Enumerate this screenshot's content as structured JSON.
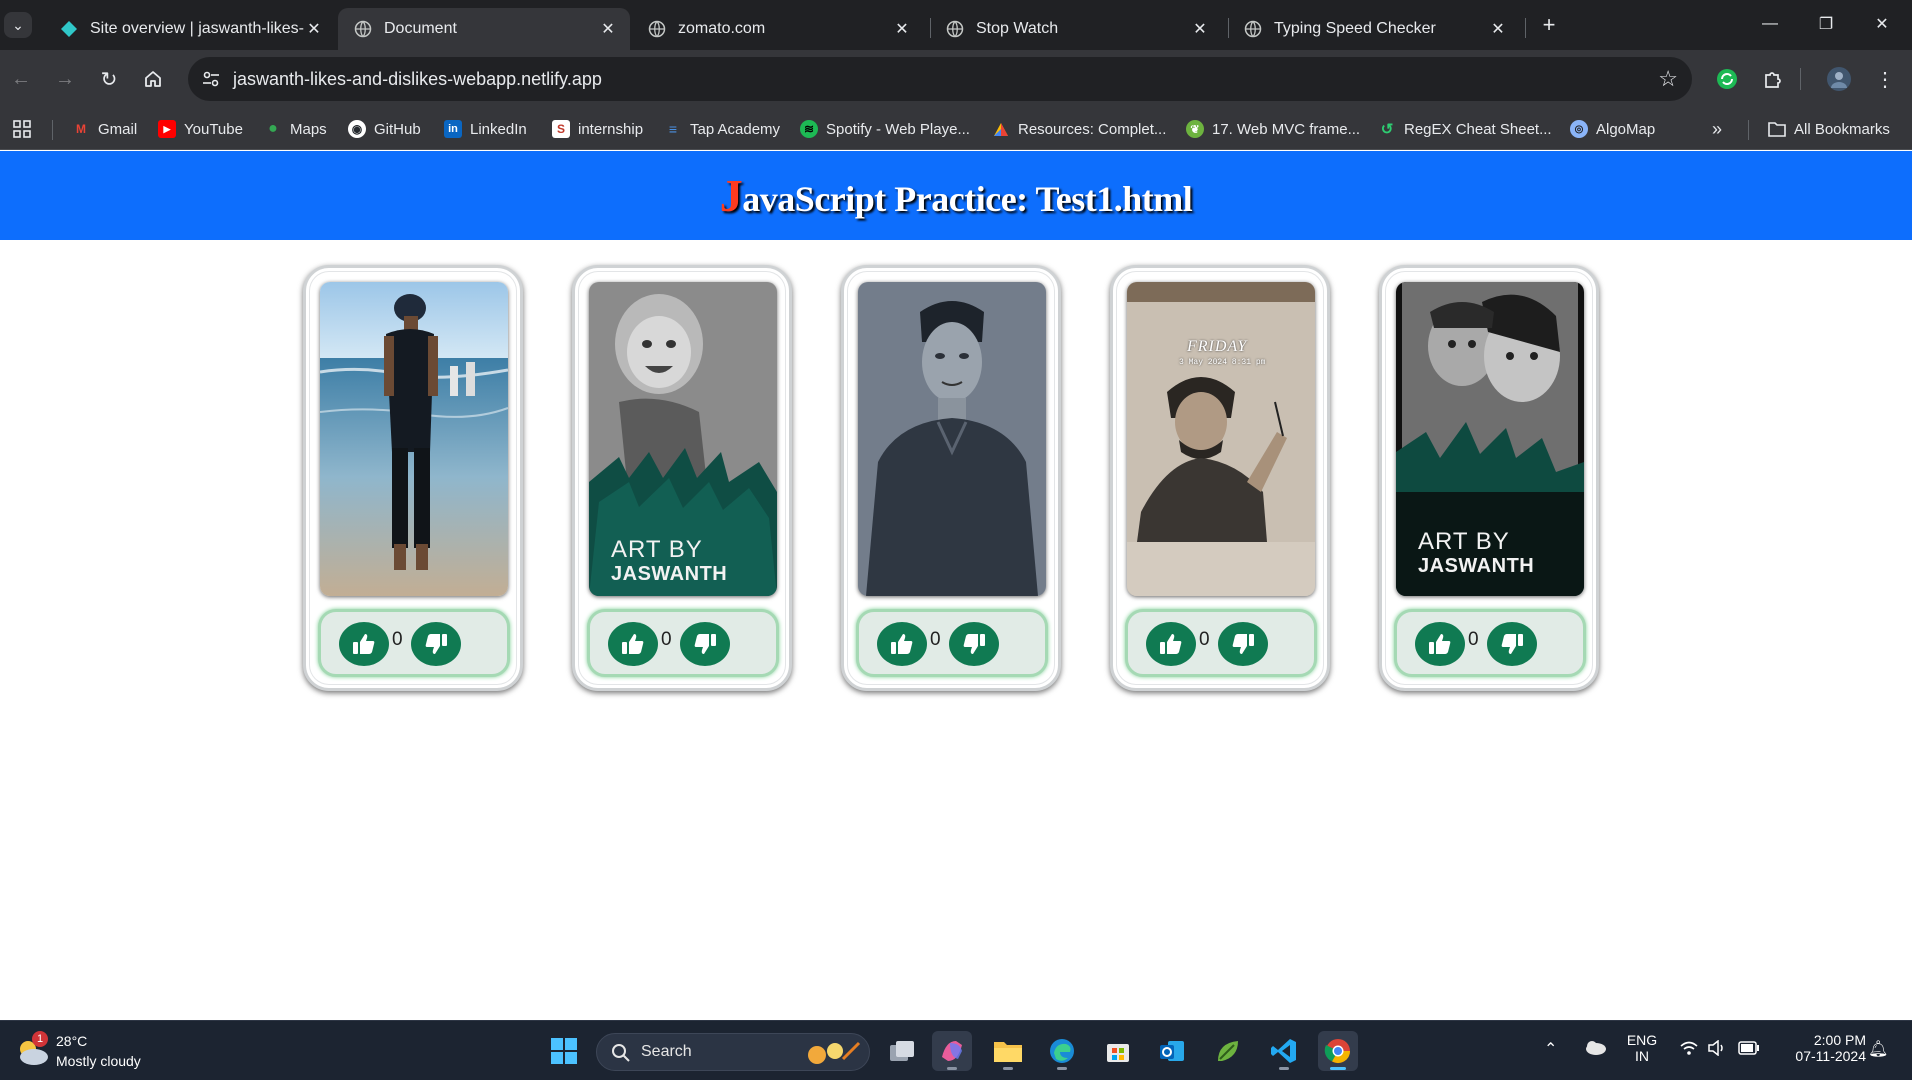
{
  "browser": {
    "tabs": [
      {
        "title": "Site overview | jaswanth-likes-a",
        "icon": "netlify-icon",
        "active": false
      },
      {
        "title": "Document",
        "icon": "globe-icon",
        "active": true
      },
      {
        "title": "zomato.com",
        "icon": "globe-icon",
        "active": false
      },
      {
        "title": "Stop Watch",
        "icon": "globe-icon",
        "active": false
      },
      {
        "title": "Typing Speed Checker",
        "icon": "globe-icon",
        "active": false
      }
    ],
    "address": "jaswanth-likes-and-dislikes-webapp.netlify.app",
    "bookmarks": [
      {
        "label": "Gmail",
        "icon": "gmail-icon",
        "color": "#ea4335"
      },
      {
        "label": "YouTube",
        "icon": "youtube-icon",
        "color": "#ff0000"
      },
      {
        "label": "Maps",
        "icon": "maps-icon",
        "color": "#34a853"
      },
      {
        "label": "GitHub",
        "icon": "github-icon",
        "color": "#ffffff"
      },
      {
        "label": "LinkedIn",
        "icon": "linkedin-icon",
        "color": "#0a66c2"
      },
      {
        "label": "internship",
        "icon": "internship-icon",
        "color": "#e8eaed"
      },
      {
        "label": "Tap Academy",
        "icon": "tap-academy-icon",
        "color": "#4a90e2"
      },
      {
        "label": "Spotify - Web Playe...",
        "icon": "spotify-icon",
        "color": "#1db954"
      },
      {
        "label": "Resources: Complet...",
        "icon": "resources-icon",
        "color": "#fbbc05"
      },
      {
        "label": "17. Web MVC frame...",
        "icon": "spring-icon",
        "color": "#6db33f"
      },
      {
        "label": "RegEX Cheat Sheet...",
        "icon": "regex-icon",
        "color": "#2ecc71"
      },
      {
        "label": "AlgoMap",
        "icon": "algomap-icon",
        "color": "#8ab4f8"
      }
    ],
    "all_bookmarks": "All Bookmarks"
  },
  "page": {
    "title_first": "J",
    "title_rest": "avaScript Practice: Test1.html",
    "cards": [
      {
        "image": "beach-photo",
        "likes": "0"
      },
      {
        "image": "girl-sketch",
        "likes": "0",
        "watermark_line1": "ART BY",
        "watermark_line2": "JASWANTH"
      },
      {
        "image": "man-sketch",
        "likes": "0"
      },
      {
        "image": "friday-sketch",
        "likes": "0",
        "sketch_heading": "FRIDAY",
        "sketch_date": "3 May 2024 8:31 pm"
      },
      {
        "image": "couple-sketch",
        "likes": "0",
        "watermark_line1": "ART BY",
        "watermark_line2": "JASWANTH"
      }
    ]
  },
  "taskbar": {
    "weather_temp": "28°C",
    "weather_desc": "Mostly cloudy",
    "weather_badge": "1",
    "search_label": "Search",
    "lang_line1": "ENG",
    "lang_line2": "IN",
    "time": "2:00 PM",
    "date": "07-11-2024"
  },
  "colors": {
    "header_bg": "#0d6efd",
    "button_green": "#107a52",
    "like_bar_bg": "#e1ebe6"
  }
}
